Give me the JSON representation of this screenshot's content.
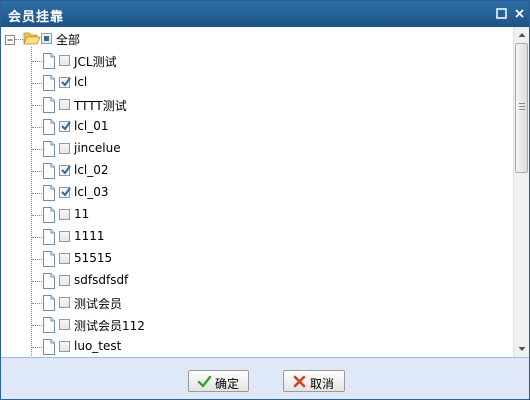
{
  "window": {
    "title": "会员挂靠"
  },
  "tree": {
    "root": {
      "label": "全部",
      "state": "partial",
      "icon": "folder-open-icon"
    },
    "items": [
      {
        "label": "JCL测试",
        "checked": false
      },
      {
        "label": "lcl",
        "checked": true
      },
      {
        "label": "TTTT测试",
        "checked": false
      },
      {
        "label": "lcl_01",
        "checked": true
      },
      {
        "label": "jincelue",
        "checked": false
      },
      {
        "label": "lcl_02",
        "checked": true
      },
      {
        "label": "lcl_03",
        "checked": true
      },
      {
        "label": "11",
        "checked": false
      },
      {
        "label": "1111",
        "checked": false
      },
      {
        "label": "51515",
        "checked": false
      },
      {
        "label": "sdfsdfsdf",
        "checked": false
      },
      {
        "label": "测试会员",
        "checked": false
      },
      {
        "label": "测试会员112",
        "checked": false
      },
      {
        "label": "luo_test",
        "checked": false
      }
    ]
  },
  "buttons": {
    "confirm": "确定",
    "cancel": "取消"
  },
  "colors": {
    "titlebar": "#1d5487",
    "footer": "#dfe8f6",
    "check": "#2d6aa3"
  }
}
